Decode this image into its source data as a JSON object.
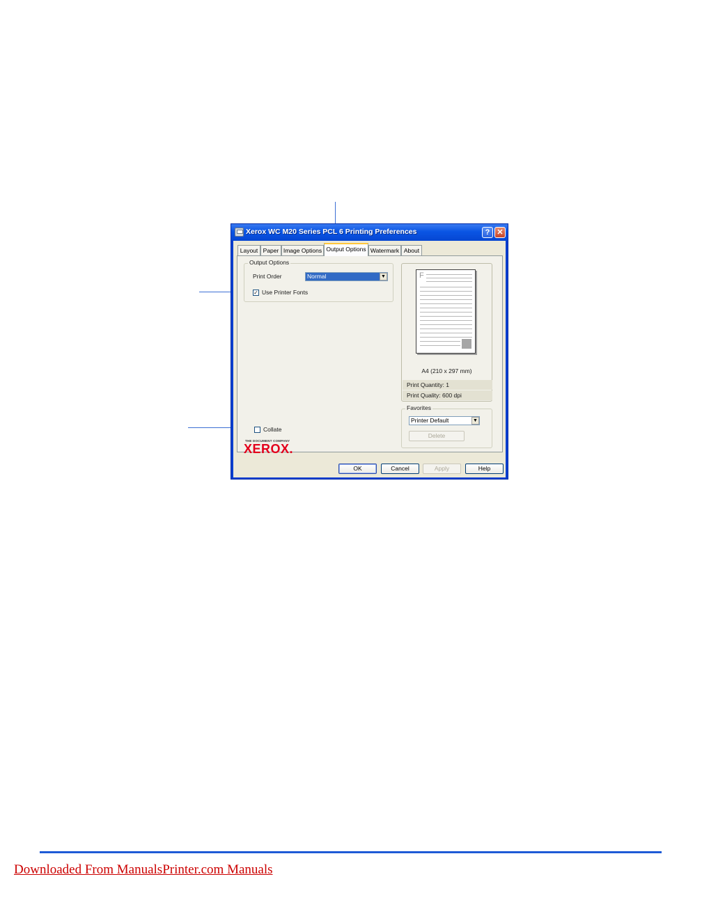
{
  "dialog": {
    "title": "Xerox WC M20 Series PCL 6 Printing Preferences",
    "help_button": "?",
    "close_button": "✕",
    "tabs": [
      {
        "label": "Layout",
        "active": false
      },
      {
        "label": "Paper",
        "active": false
      },
      {
        "label": "Image Options",
        "active": false
      },
      {
        "label": "Output Options",
        "active": true
      },
      {
        "label": "Watermark",
        "active": false
      },
      {
        "label": "About",
        "active": false
      }
    ],
    "output_options": {
      "group_label": "Output Options",
      "print_order_label": "Print Order",
      "print_order_value": "Normal",
      "use_printer_fonts_label": "Use Printer Fonts",
      "use_printer_fonts_checked": true
    },
    "collate": {
      "label": "Collate",
      "checked": false
    },
    "preview": {
      "page_letter": "F",
      "paper_size": "A4 (210 x 297 mm)",
      "print_quantity": "Print Quantity: 1",
      "print_quality": "Print Quality: 600 dpi"
    },
    "favorites": {
      "group_label": "Favorites",
      "selected": "Printer Default",
      "delete_label": "Delete"
    },
    "logo": {
      "tagline": "THE DOCUMENT COMPANY",
      "wordmark": "XEROX."
    },
    "buttons": {
      "ok": "OK",
      "cancel": "Cancel",
      "apply": "Apply",
      "help": "Help"
    }
  },
  "footer": {
    "link_text": "Downloaded From ManualsPrinter.com Manuals"
  },
  "colors": {
    "accent": "#1e5bd6",
    "link": "#cc0000",
    "titlebar": "#0a55e4",
    "xerox_red": "#e3001b"
  }
}
